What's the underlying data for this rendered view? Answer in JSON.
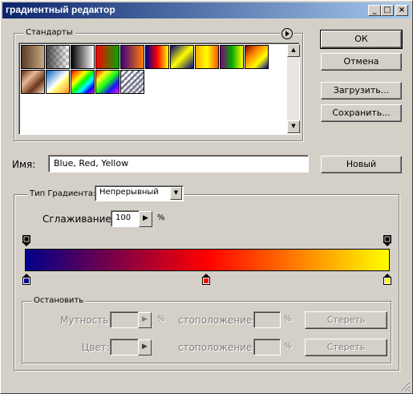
{
  "window": {
    "title": "градиентный редактор",
    "controls": {
      "minimize": "_",
      "maximize": "□",
      "close": "×"
    }
  },
  "presets": {
    "label": "Стандарты",
    "menu_icon": "arrow-circle-icon"
  },
  "buttons": {
    "ok": "ОК",
    "cancel": "Отмена",
    "load": "Загрузить...",
    "save": "Сохранить...",
    "new": "Новый"
  },
  "name_field": {
    "label": "Имя:",
    "value": "Blue, Red, Yellow"
  },
  "gradient_type": {
    "label": "Тип Градиента:",
    "value": "Непрерывный"
  },
  "smoothness": {
    "label": "Сглаживание:",
    "value": "100",
    "unit": "%"
  },
  "gradient_colors": [
    "#00008b",
    "#ff0000",
    "#ffff00"
  ],
  "stops": {
    "label": "Остановить",
    "opacity_label": "Мутность:",
    "opacity_unit": "%",
    "opacity_location_label": "стоположение:",
    "opacity_location_unit": "%",
    "opacity_delete": "Стереть",
    "color_label": "Цвет:",
    "color_location_label": "стоположение:",
    "color_location_unit": "%",
    "color_delete": "Стереть"
  }
}
